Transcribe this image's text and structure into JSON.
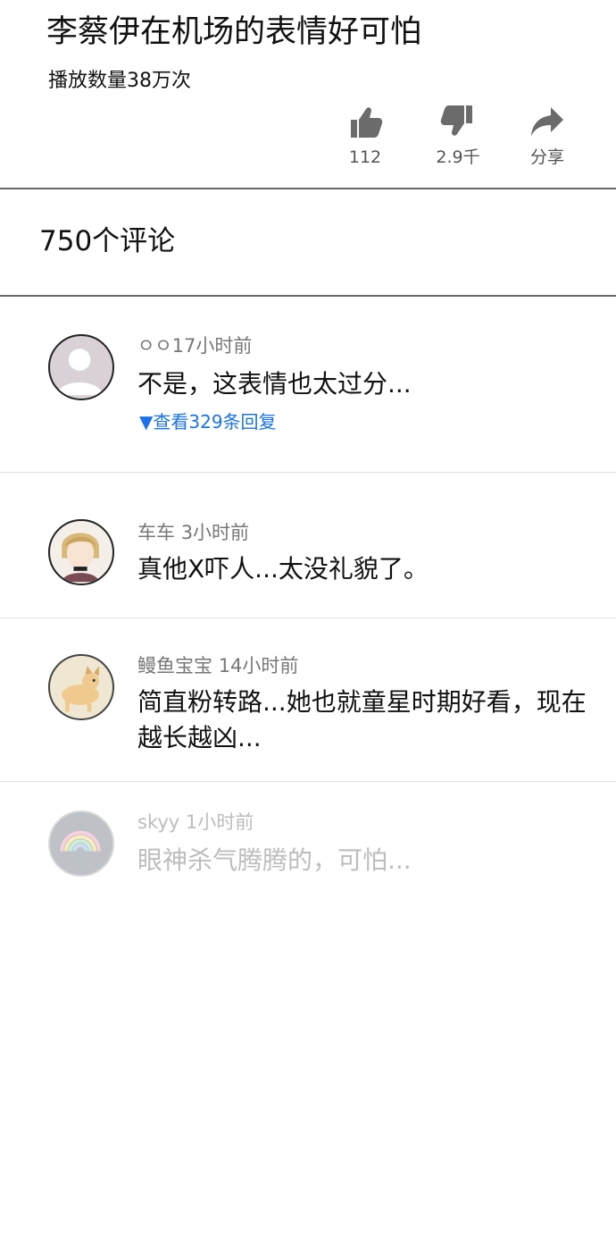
{
  "video": {
    "title": "李蔡伊在机场的表情好可怕",
    "views": "播放数量38万次"
  },
  "actions": {
    "like": {
      "icon": "thumbs-up-icon",
      "label": "112"
    },
    "dislike": {
      "icon": "thumbs-down-icon",
      "label": "2.9千"
    },
    "share": {
      "icon": "share-arrow-icon",
      "label": "分享"
    }
  },
  "comments_header": "750个评论",
  "comments": [
    {
      "avatar": "default-user-avatar",
      "author": "ㅇㅇ",
      "time": "17小时前",
      "text": "不是，这表情也太过分...",
      "replies": "▼查看329条回复"
    },
    {
      "avatar": "cartoon-singer-avatar",
      "author": "车车",
      "time": "3小时前",
      "text": "真他X吓人...太没礼貌了。"
    },
    {
      "avatar": "dog-avatar",
      "author": "鳗鱼宝宝",
      "time": "14小时前",
      "text": "简直粉转路...她也就童星时期好看，现在越长越凶..."
    },
    {
      "avatar": "rainbow-avatar",
      "author": "skyy",
      "time": "1小时前",
      "text": "眼神杀气腾腾的，可怕..."
    }
  ],
  "colors": {
    "link": "#1a73e8",
    "meta": "#777777",
    "divider": "#666666"
  }
}
